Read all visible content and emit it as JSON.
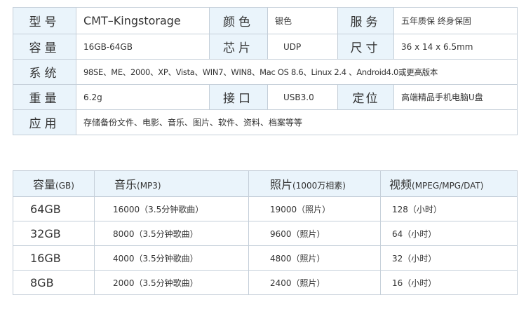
{
  "spec": {
    "model_label": "型号",
    "model_value": "CMT–Kingstorage",
    "color_label": "颜色",
    "color_value": "银色",
    "service_label": "服务",
    "service_value": "五年质保 终身保固",
    "capacity_label": "容量",
    "capacity_value": "16GB-64GB",
    "chip_label": "芯片",
    "chip_value": "UDP",
    "size_label": "尺寸",
    "size_value": "36 x 14 x 6.5mm",
    "system_label": "系统",
    "system_value": "98SE、ME、2000、XP、Vista、WIN7、WIN8、Mac OS 8.6、Linux 2.4 、Android4.0或更高版本",
    "weight_label": "重量",
    "weight_value": "6.2g",
    "interface_label": "接口",
    "interface_value": "USB3.0",
    "position_label": "定位",
    "position_value": "高端精品手机电脑U盘",
    "usage_label": "应用",
    "usage_value": "存储备份文件、电影、音乐、图片、软件、资料、档案等等"
  },
  "capacity_table": {
    "headers": [
      {
        "main": "容量",
        "sub": "(GB)"
      },
      {
        "main": "音乐",
        "sub": "(MP3)"
      },
      {
        "main": "照片",
        "sub": "(1000万相素)"
      },
      {
        "main": "视频",
        "sub": "(MPEG/MPG/DAT)"
      }
    ],
    "rows": [
      {
        "size": "64GB",
        "music": "16000（3.5分钟歌曲）",
        "photo": "19000（照片）",
        "video": "128（小时）"
      },
      {
        "size": "32GB",
        "music": "8000（3.5分钟歌曲）",
        "photo": "9600（照片）",
        "video": "64（小时）"
      },
      {
        "size": "16GB",
        "music": "4000（3.5分钟歌曲）",
        "photo": "4800（照片）",
        "video": "32（小时）"
      },
      {
        "size": "8GB",
        "music": "2000（3.5分钟歌曲）",
        "photo": "2400（照片）",
        "video": "16（小时）"
      }
    ]
  },
  "colors": {
    "header_bg": "#eaf4fb",
    "border": "#c5cfd9",
    "text": "#333333"
  }
}
